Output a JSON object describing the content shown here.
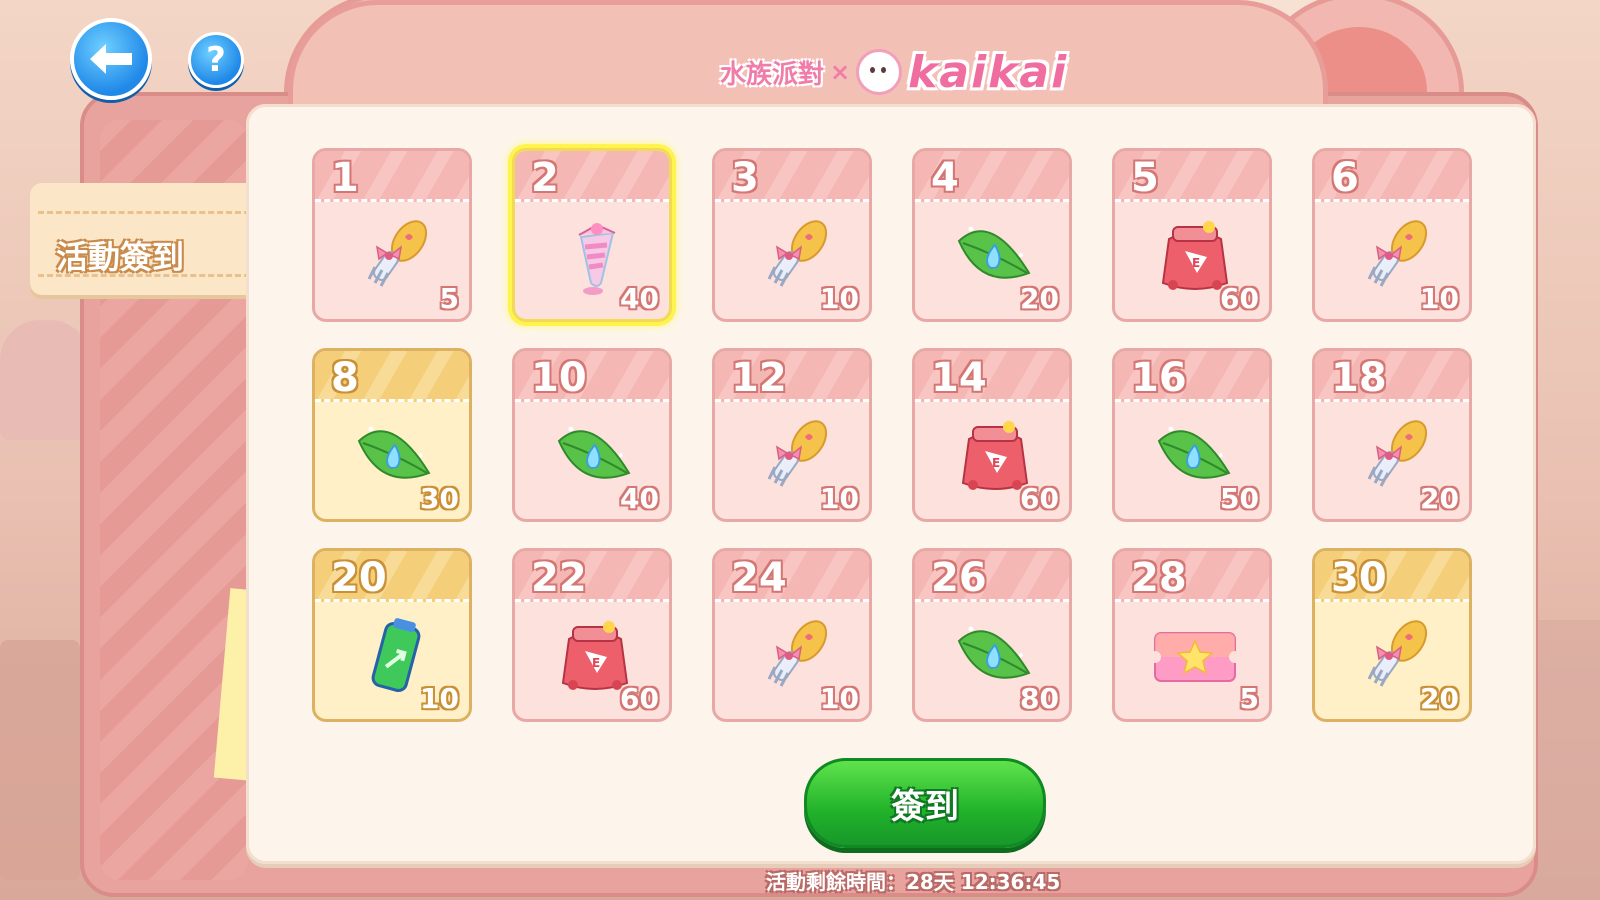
{
  "header": {
    "logo_cn": "水族派對",
    "logo_x": "×",
    "logo_en": "kaikai"
  },
  "nav": {
    "help_label": "?"
  },
  "side_tab": {
    "label": "活動簽到"
  },
  "items": [
    {
      "day": "1",
      "qty": "5",
      "icon": "fork-hairpin-icon",
      "style": "pink"
    },
    {
      "day": "2",
      "qty": "40",
      "icon": "candy-bag-icon",
      "style": "current"
    },
    {
      "day": "3",
      "qty": "10",
      "icon": "fork-hairpin-icon",
      "style": "pink"
    },
    {
      "day": "4",
      "qty": "20",
      "icon": "leaf-droplet-icon",
      "style": "pink"
    },
    {
      "day": "5",
      "qty": "60",
      "icon": "red-pouch-icon",
      "style": "pink"
    },
    {
      "day": "6",
      "qty": "10",
      "icon": "fork-hairpin-icon",
      "style": "pink"
    },
    {
      "day": "8",
      "qty": "30",
      "icon": "leaf-droplet-icon",
      "style": "gold"
    },
    {
      "day": "10",
      "qty": "40",
      "icon": "leaf-droplet-icon",
      "style": "pink"
    },
    {
      "day": "12",
      "qty": "10",
      "icon": "fork-hairpin-icon",
      "style": "pink"
    },
    {
      "day": "14",
      "qty": "60",
      "icon": "red-pouch-icon",
      "style": "pink"
    },
    {
      "day": "16",
      "qty": "50",
      "icon": "leaf-droplet-icon",
      "style": "pink"
    },
    {
      "day": "18",
      "qty": "20",
      "icon": "fork-hairpin-icon",
      "style": "pink"
    },
    {
      "day": "20",
      "qty": "10",
      "icon": "battery-icon",
      "style": "gold"
    },
    {
      "day": "22",
      "qty": "60",
      "icon": "red-pouch-icon",
      "style": "pink"
    },
    {
      "day": "24",
      "qty": "10",
      "icon": "fork-hairpin-icon",
      "style": "pink"
    },
    {
      "day": "26",
      "qty": "80",
      "icon": "leaf-droplet-icon",
      "style": "pink"
    },
    {
      "day": "28",
      "qty": "5",
      "icon": "star-ticket-icon",
      "style": "pink"
    },
    {
      "day": "30",
      "qty": "20",
      "icon": "fork-hairpin-icon",
      "style": "gold"
    }
  ],
  "signin_button": {
    "label": "簽到"
  },
  "footer": {
    "timer_text": "活動剩餘時間：28天 12:36:45"
  }
}
